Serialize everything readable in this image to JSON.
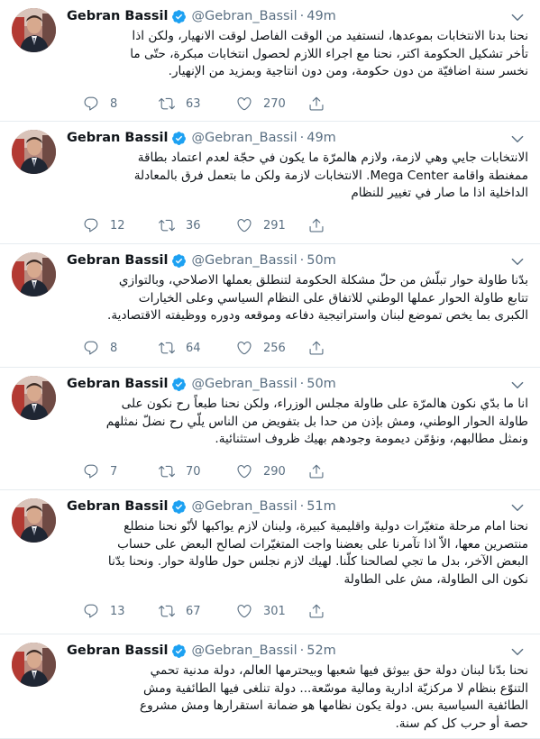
{
  "author": {
    "name": "Gebran Bassil",
    "handle": "@Gebran_Bassil"
  },
  "colors": {
    "text": "#0f1419",
    "secondary": "#5b7083",
    "verified": "#1da1f2",
    "divider": "#e6ecf0"
  },
  "icons": {
    "reply": "reply-icon",
    "retweet": "retweet-icon",
    "like": "heart-icon",
    "share": "share-icon",
    "verified": "verified-badge-icon",
    "caret": "chevron-down-icon"
  },
  "tweets": [
    {
      "time": "49m",
      "lines": [
        "نحنا بدنا الانتخابات بموعدها، لنستفيد من الوقت الفاصل لوقت الانهيار، ولكن اذا",
        "تأخر تشكيل الحكومة اكتر، نحنا مع اجراء اللازم لحصول انتخابات مبكرة، حتّى ما",
        "نخسر سنة اضافيّة من دون حكومة، ومن دون انتاجية وبمزيد من الإنهيار."
      ],
      "replies": "8",
      "retweets": "63",
      "likes": "270"
    },
    {
      "time": "49m",
      "lines": [
        "الانتخابات جايي وهي لازمة، ولازم هالمرّة ما يكون في حجّة لعدم اعتماد بطاقة",
        "ممغنطة واقامة Mega Center. الانتخابات لازمة ولكن ما بتعمل فرق بالمعادلة",
        "الداخلية اذا ما صار في تغيير للنظام"
      ],
      "replies": "12",
      "retweets": "36",
      "likes": "291"
    },
    {
      "time": "50m",
      "lines": [
        "بدّنا طاولة حوار تبلّش من حلّ مشكلة الحكومة لتنطلق بعملها الاصلاحي، وبالتوازي",
        "تتابع طاولة الحوار عملها الوطني للاتفاق على النظام السياسي وعلى الخيارات",
        "الكبرى بما يخص تموضع لبنان واستراتيجية دفاعه وموقعه ودوره ووظيفته الاقتصادية."
      ],
      "replies": "8",
      "retweets": "64",
      "likes": "256"
    },
    {
      "time": "50m",
      "lines": [
        "انا ما بدّي نكون هالمرّة على طاولة مجلس الوزراء، ولكن نحنا طبعاً رح نكون على",
        "طاولة الحوار الوطني، ومش بإذن من حدا بل بتفويض من الناس يلّي رح نضلّ نمثلهم",
        "ونمثل مطالبهم، ونؤمّن ديمومة وجودهم بهيك ظروف استثنائية."
      ],
      "replies": "7",
      "retweets": "70",
      "likes": "290"
    },
    {
      "time": "51m",
      "lines": [
        "نحنا امام مرحلة متغيّرات دولية واقليمية كبيرة، ولبنان لازم يواكبها لأنّو نحنا منطلع",
        "منتصرين معها، الاّ اذا تآمرنا على بعضنا واجت المتغيّرات لصالح البعض على حساب",
        "البعض الآخر، بدل ما تجي لصالحنا كلّنا. لهيك لازم نجلس حول طاولة حوار. ونحنا بدّنا",
        "نكون الى الطاولة، مش على الطاولة"
      ],
      "replies": "13",
      "retweets": "67",
      "likes": "301"
    },
    {
      "time": "52m",
      "lines": [
        "نحنا بدّنا لبنان دولة حق بيوثق فيها شعبها وبيحترمها العالم، دولة مدنية تحمي",
        "التنوّع بنظام لا مركزيّة ادارية ومالية موسّعة... دولة تنلغى فيها الطائفية ومش",
        "الطائفية السياسية بس. دولة يكون نظامها هو ضمانة استقرارها ومش مشروع",
        "حصة أو حرب كل كم سنة."
      ],
      "replies": "",
      "retweets": "",
      "likes": ""
    }
  ]
}
